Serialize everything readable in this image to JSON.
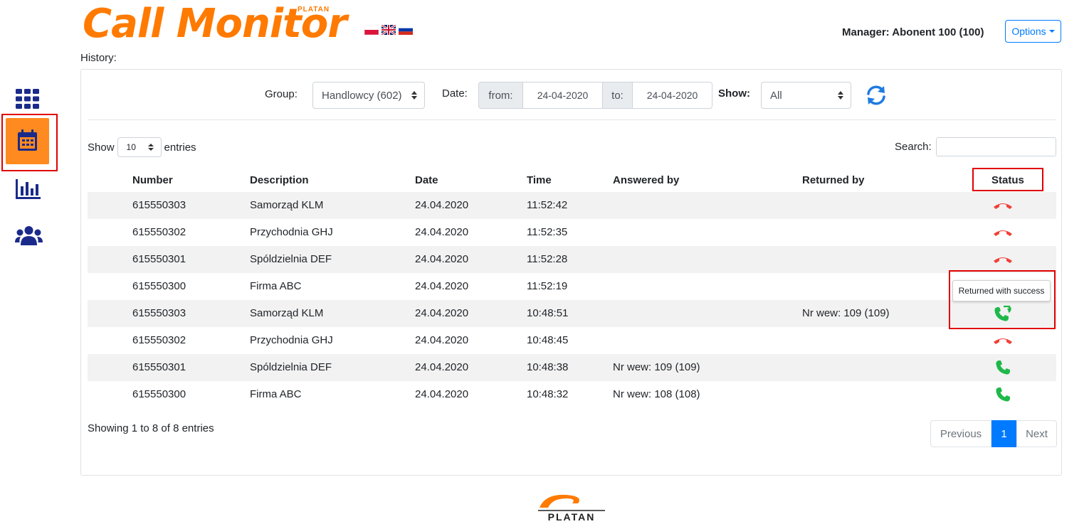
{
  "header": {
    "logo_title": "Call Monitor",
    "logo_brand": "PLATAN",
    "languages": [
      "pl",
      "en",
      "ru"
    ],
    "manager": "Manager: Abonent 100 (100)",
    "options_label": "Options",
    "history_label": "History:"
  },
  "sidebar": {
    "items": [
      {
        "icon": "grid-icon"
      },
      {
        "icon": "calendar-icon",
        "active": true
      },
      {
        "icon": "bar-chart-icon"
      },
      {
        "icon": "users-icon"
      }
    ]
  },
  "filters": {
    "group_label": "Group:",
    "group_value": "Handlowcy (602)",
    "date_label": "Date:",
    "from_label": "from:",
    "from_value": "24-04-2020",
    "to_label": "to:",
    "to_value": "24-04-2020",
    "show_label": "Show:",
    "show_value": "All"
  },
  "table_controls": {
    "show_prefix": "Show",
    "page_size": "10",
    "show_suffix": "entries",
    "search_label": "Search:",
    "search_value": ""
  },
  "table": {
    "columns": [
      "Number",
      "Description",
      "Date",
      "Time",
      "Answered by",
      "Returned by",
      "Status"
    ],
    "rows": [
      {
        "number": "615550303",
        "description": "Samorząd KLM",
        "date": "24.04.2020",
        "time": "11:52:42",
        "answered_by": "",
        "returned_by": "",
        "status": "missed"
      },
      {
        "number": "615550302",
        "description": "Przychodnia GHJ",
        "date": "24.04.2020",
        "time": "11:52:35",
        "answered_by": "",
        "returned_by": "",
        "status": "missed"
      },
      {
        "number": "615550301",
        "description": "Spóldzielnia DEF",
        "date": "24.04.2020",
        "time": "11:52:28",
        "answered_by": "",
        "returned_by": "",
        "status": "missed"
      },
      {
        "number": "615550300",
        "description": "Firma ABC",
        "date": "24.04.2020",
        "time": "11:52:19",
        "answered_by": "",
        "returned_by": "",
        "status": "missed"
      },
      {
        "number": "615550303",
        "description": "Samorząd KLM",
        "date": "24.04.2020",
        "time": "10:48:51",
        "answered_by": "",
        "returned_by": "Nr wew: 109 (109)",
        "status": "returned"
      },
      {
        "number": "615550302",
        "description": "Przychodnia GHJ",
        "date": "24.04.2020",
        "time": "10:48:45",
        "answered_by": "",
        "returned_by": "",
        "status": "missed"
      },
      {
        "number": "615550301",
        "description": "Spóldzielnia DEF",
        "date": "24.04.2020",
        "time": "10:48:38",
        "answered_by": "Nr wew: 109 (109)",
        "returned_by": "",
        "status": "answered"
      },
      {
        "number": "615550300",
        "description": "Firma ABC",
        "date": "24.04.2020",
        "time": "10:48:32",
        "answered_by": "Nr wew: 108 (108)",
        "returned_by": "",
        "status": "answered"
      }
    ]
  },
  "tooltip": "Returned with success",
  "footer": {
    "info": "Showing 1 to 8 of 8 entries",
    "pagination": {
      "previous": "Previous",
      "current": "1",
      "next": "Next"
    },
    "brand": "PLATAN"
  },
  "colors": {
    "brand_orange": "#ff7a00",
    "accent_blue": "#007bff",
    "missed_red": "#f0413a",
    "answered_green": "#1fb84a",
    "sidebar_navy": "#1a2a8a",
    "highlight_red": "#e00000"
  }
}
